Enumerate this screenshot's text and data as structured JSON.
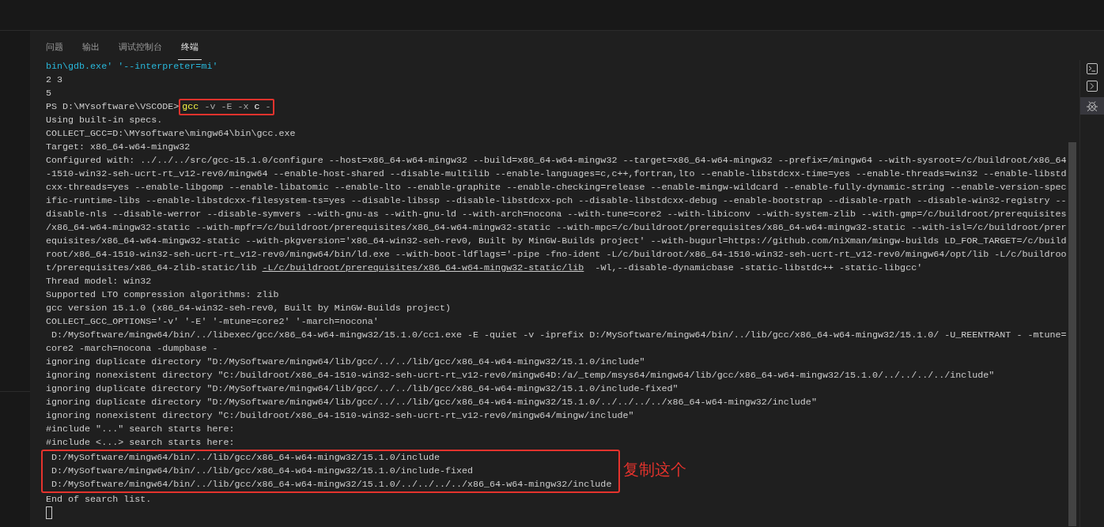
{
  "panel_tabs": [
    {
      "label": "问题",
      "selected": false
    },
    {
      "label": "输出",
      "selected": false
    },
    {
      "label": "调试控制台",
      "selected": false
    },
    {
      "label": "终端",
      "selected": true
    }
  ],
  "terminal": {
    "lines_before": [
      {
        "kind": "info",
        "text": "bin\\gdb.exe' '--interpreter=mi'"
      },
      {
        "kind": "output",
        "text": "2 3"
      },
      {
        "kind": "output",
        "text": "5"
      },
      {
        "kind": "prompt",
        "prompt": "PS D:\\MYsoftware\\VSCODE>",
        "boxed": true,
        "segments": [
          {
            "kind": "command",
            "text": "gcc"
          },
          {
            "kind": "flag",
            "text": "-v"
          },
          {
            "kind": "flag",
            "text": "-E"
          },
          {
            "kind": "flag",
            "text": "-x"
          },
          {
            "kind": "arg",
            "text": "c"
          },
          {
            "kind": "flag",
            "text": "-"
          }
        ]
      },
      {
        "kind": "output",
        "text": "Using built-in specs."
      },
      {
        "kind": "output",
        "text": "COLLECT_GCC=D:\\MYsoftware\\mingw64\\bin\\gcc.exe"
      },
      {
        "kind": "output",
        "text": "Target: x86_64-w64-mingw32"
      },
      {
        "kind": "output",
        "text": "Configured with: ../../../src/gcc-15.1.0/configure --host=x86_64-w64-mingw32 --build=x86_64-w64-mingw32 --target=x86_64-w64-mingw32 --prefix=/mingw64 --with-sysroot=/c/buildroot/x86_64"
      },
      {
        "kind": "output",
        "text": "-1510-win32-seh-ucrt-rt_v12-rev0/mingw64 --enable-host-shared --disable-multilib --enable-languages=c,c++,fortran,lto --enable-libstdcxx-time=yes --enable-threads=win32 --enable-libstd"
      },
      {
        "kind": "output",
        "text": "cxx-threads=yes --enable-libgomp --enable-libatomic --enable-lto --enable-graphite --enable-checking=release --enable-mingw-wildcard --enable-fully-dynamic-string --enable-version-spec"
      },
      {
        "kind": "output",
        "text": "ific-runtime-libs --enable-libstdcxx-filesystem-ts=yes --disable-libssp --disable-libstdcxx-pch --disable-libstdcxx-debug --enable-bootstrap --disable-rpath --disable-win32-registry --"
      },
      {
        "kind": "output",
        "text": "disable-nls --disable-werror --disable-symvers --with-gnu-as --with-gnu-ld --with-arch=nocona --with-tune=core2 --with-libiconv --with-system-zlib --with-gmp=/c/buildroot/prerequisites"
      },
      {
        "kind": "output",
        "text": "/x86_64-w64-mingw32-static --with-mpfr=/c/buildroot/prerequisites/x86_64-w64-mingw32-static --with-mpc=/c/buildroot/prerequisites/x86_64-w64-mingw32-static --with-isl=/c/buildroot/prer"
      },
      {
        "kind": "output",
        "text": "equisites/x86_64-w64-mingw32-static --with-pkgversion='x86_64-win32-seh-rev0, Built by MinGW-Builds project' --with-bugurl=https://github.com/niXman/mingw-builds LD_FOR_TARGET=/c/build"
      },
      {
        "kind": "output",
        "text": "root/x86_64-1510-win32-seh-ucrt-rt_v12-rev0/mingw64/bin/ld.exe --with-boot-ldflags='-pipe -fno-ident -L/c/buildroot/x86_64-1510-win32-seh-ucrt-rt_v12-rev0/mingw64/opt/lib -L/c/buildroo"
      },
      {
        "kind": "segments",
        "segments": [
          {
            "kind": "text",
            "text": "t/prerequisites/x86_64-zlib-static/lib"
          },
          {
            "kind": "link",
            "text": "-L/c/buildroot/prerequisites/x86_64-w64-mingw32-static/lib"
          },
          {
            "kind": "text",
            "text": " -Wl,--disable-dynamicbase -static-libstdc++ -static-libgcc'"
          }
        ]
      },
      {
        "kind": "output",
        "text": "Thread model: win32"
      },
      {
        "kind": "output",
        "text": "Supported LTO compression algorithms: zlib"
      },
      {
        "kind": "output",
        "text": "gcc version 15.1.0 (x86_64-win32-seh-rev0, Built by MinGW-Builds project)"
      },
      {
        "kind": "output",
        "text": "COLLECT_GCC_OPTIONS='-v' '-E' '-mtune=core2' '-march=nocona'"
      },
      {
        "kind": "output",
        "text": " D:/MySoftware/mingw64/bin/../libexec/gcc/x86_64-w64-mingw32/15.1.0/cc1.exe -E -quiet -v -iprefix D:/MySoftware/mingw64/bin/../lib/gcc/x86_64-w64-mingw32/15.1.0/ -U_REENTRANT - -mtune="
      },
      {
        "kind": "output",
        "text": "core2 -march=nocona -dumpbase -"
      },
      {
        "kind": "output",
        "text": "ignoring duplicate directory \"D:/MySoftware/mingw64/lib/gcc/../../lib/gcc/x86_64-w64-mingw32/15.1.0/include\""
      },
      {
        "kind": "output",
        "text": "ignoring nonexistent directory \"C:/buildroot/x86_64-1510-win32-seh-ucrt-rt_v12-rev0/mingw64D:/a/_temp/msys64/mingw64/lib/gcc/x86_64-w64-mingw32/15.1.0/../../../../include\""
      },
      {
        "kind": "output",
        "text": "ignoring duplicate directory \"D:/MySoftware/mingw64/lib/gcc/../../lib/gcc/x86_64-w64-mingw32/15.1.0/include-fixed\""
      },
      {
        "kind": "output",
        "text": "ignoring duplicate directory \"D:/MySoftware/mingw64/lib/gcc/../../lib/gcc/x86_64-w64-mingw32/15.1.0/../../../../x86_64-w64-mingw32/include\""
      },
      {
        "kind": "output",
        "text": "ignoring nonexistent directory \"C:/buildroot/x86_64-1510-win32-seh-ucrt-rt_v12-rev0/mingw64/mingw/include\""
      },
      {
        "kind": "output",
        "text": "#include \"...\" search starts here:"
      },
      {
        "kind": "output",
        "text": "#include <...> search starts here:"
      }
    ],
    "marked_block": {
      "note": "复制这个",
      "lines": [
        " D:/MySoftware/mingw64/bin/../lib/gcc/x86_64-w64-mingw32/15.1.0/include",
        " D:/MySoftware/mingw64/bin/../lib/gcc/x86_64-w64-mingw32/15.1.0/include-fixed",
        " D:/MySoftware/mingw64/bin/../lib/gcc/x86_64-w64-mingw32/15.1.0/../../../../x86_64-w64-mingw32/include"
      ]
    },
    "lines_after": [
      "End of search list."
    ]
  }
}
